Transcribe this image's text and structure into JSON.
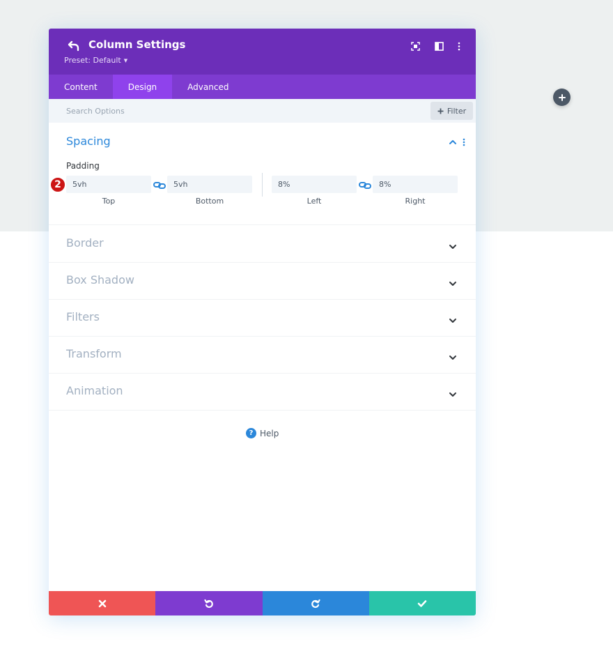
{
  "colors": {
    "header_bg": "#6c2eb9",
    "tabs_bg": "#7e3bd0",
    "tab_active_bg": "#8f42ec",
    "accent_blue": "#2b87da",
    "cancel": "#ef5555",
    "undo": "#7e3bd0",
    "redo": "#2b87da",
    "save": "#29c4a9",
    "badge": "#cc1515"
  },
  "header": {
    "title": "Column Settings",
    "preset": "Preset: Default",
    "icons": [
      "undo-back-icon",
      "focus-icon",
      "split-view-icon",
      "kebab-menu-icon"
    ]
  },
  "tabs": [
    {
      "label": "Content",
      "active": false
    },
    {
      "label": "Design",
      "active": true
    },
    {
      "label": "Advanced",
      "active": false
    }
  ],
  "search": {
    "placeholder": "Search Options",
    "filter_label": "Filter"
  },
  "spacing": {
    "title": "Spacing",
    "padding_label": "Padding",
    "badge": "2",
    "fields": [
      {
        "caption": "Top",
        "value": "5vh"
      },
      {
        "caption": "Bottom",
        "value": "5vh"
      },
      {
        "caption": "Left",
        "value": "8%"
      },
      {
        "caption": "Right",
        "value": "8%"
      }
    ]
  },
  "sections": [
    "Border",
    "Box Shadow",
    "Filters",
    "Transform",
    "Animation"
  ],
  "help_label": "Help",
  "footer": [
    "cancel-icon",
    "undo-icon",
    "redo-icon",
    "check-icon"
  ]
}
